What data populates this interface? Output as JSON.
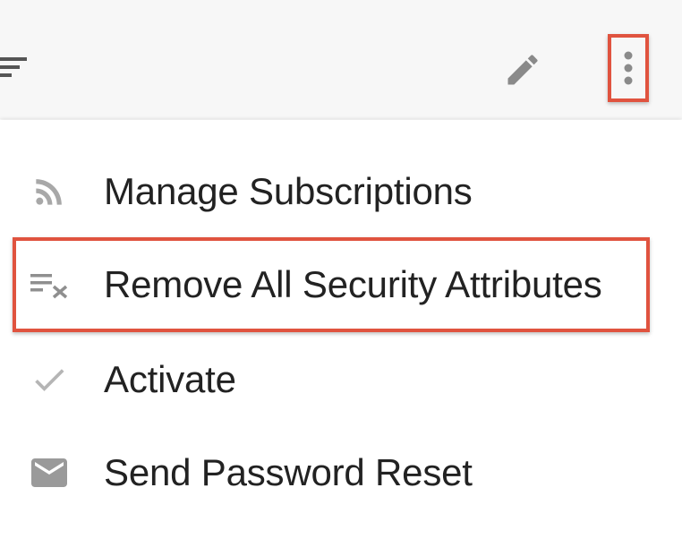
{
  "colors": {
    "highlight": "#e0533f",
    "icon_gray": "#9e9e9e",
    "text": "#222222",
    "toolbar_bg": "#f7f7f7"
  },
  "toolbar": {
    "filter_icon": "filter-list-icon",
    "edit_icon": "pencil-icon",
    "more_icon": "more-vert-icon"
  },
  "menu": {
    "items": [
      {
        "label": "Manage Subscriptions",
        "icon": "rss-feed-icon"
      },
      {
        "label": "Remove All Security Attributes",
        "icon": "clear-all-icon"
      },
      {
        "label": "Activate",
        "icon": "checkmark-icon"
      },
      {
        "label": "Send Password Reset",
        "icon": "envelope-icon"
      }
    ]
  }
}
